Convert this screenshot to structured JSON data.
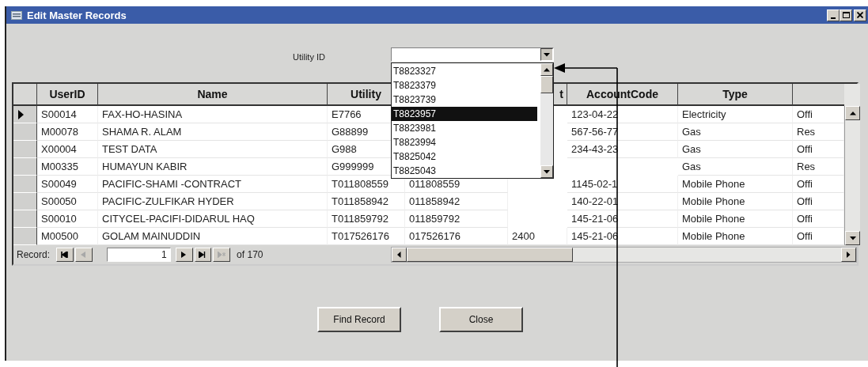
{
  "window": {
    "title": "Edit Master Records"
  },
  "utility_id": {
    "label": "Utility ID",
    "expanded": true,
    "items": [
      {
        "text": "T8823327",
        "selected": false
      },
      {
        "text": "T8823379",
        "selected": false
      },
      {
        "text": "T8823739",
        "selected": false
      },
      {
        "text": "T8823957",
        "selected": true
      },
      {
        "text": "T8823981",
        "selected": false
      },
      {
        "text": "T8823994",
        "selected": false
      },
      {
        "text": "T8825042",
        "selected": false
      },
      {
        "text": "T8825043",
        "selected": false
      }
    ]
  },
  "grid": {
    "columns": [
      {
        "label": "UserID"
      },
      {
        "label": "Name"
      },
      {
        "label": "Utility"
      },
      {},
      {
        "label": "t"
      },
      {
        "label": "AccountCode"
      },
      {
        "label": "Type"
      },
      {}
    ],
    "rows": [
      {
        "current": true,
        "cells": [
          "S00014",
          "FAX-HO-HASINA",
          "E7766",
          null,
          null,
          "123-04-22",
          "Electricity",
          "Offi"
        ]
      },
      {
        "current": false,
        "cells": [
          "M00078",
          "SHAMA R. ALAM",
          "G88899",
          null,
          null,
          "567-56-77",
          "Gas",
          "Res"
        ]
      },
      {
        "current": false,
        "cells": [
          "X00004",
          "TEST DATA",
          "G988",
          null,
          null,
          "234-43-23",
          "Gas",
          "Offi"
        ]
      },
      {
        "current": false,
        "cells": [
          "M00335",
          "HUMAYUN KABIR",
          "G999999",
          null,
          null,
          null,
          "Gas",
          "Res"
        ]
      },
      {
        "current": false,
        "cells": [
          "S00049",
          "PACIFIC-SHAMI -CONTRACT",
          "T011808559",
          "011808559",
          null,
          "1145-02-1",
          "Mobile Phone",
          "Offi"
        ]
      },
      {
        "current": false,
        "cells": [
          "S00050",
          "PACIFIC-ZULFIKAR HYDER",
          "T011858942",
          "011858942",
          null,
          "140-22-01",
          "Mobile Phone",
          "Offi"
        ]
      },
      {
        "current": false,
        "cells": [
          "S00010",
          "CITYCEL-PACIFI-DIDARUL HAQ",
          "T011859792",
          "011859792",
          null,
          "145-21-06",
          "Mobile Phone",
          "Offi"
        ]
      },
      {
        "current": false,
        "cells": [
          "M00500",
          "GOLAM MAINUDDIN",
          "T017526176",
          "017526176",
          "2400",
          "145-21-06",
          "Mobile Phone",
          "Offi"
        ]
      }
    ]
  },
  "record_nav": {
    "label": "Record:",
    "current": "1",
    "total": "of 170",
    "buttons": [
      {
        "kind": "first",
        "disabled": false
      },
      {
        "kind": "prev",
        "disabled": true
      },
      {
        "kind": "next",
        "disabled": false
      },
      {
        "kind": "last",
        "disabled": false
      },
      {
        "kind": "new",
        "disabled": true
      }
    ]
  },
  "buttons": [
    "Find Record",
    "Close"
  ]
}
